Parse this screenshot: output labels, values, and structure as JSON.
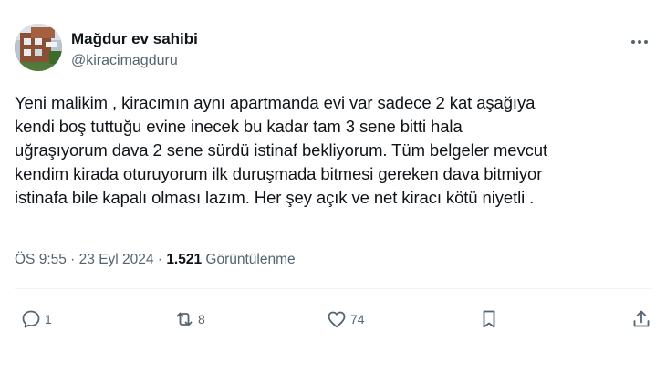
{
  "author": {
    "display_name": "Mağdur ev sahibi",
    "handle": "@kiracimagduru",
    "avatar_icon": "building-photo-avatar"
  },
  "tweet": {
    "lines": [
      "Yeni malikim , kiracımın aynı apartmanda evi var sadece 2 kat aşağıya",
      "kendi boş tuttuğu evine inecek bu kadar tam 3 sene bitti hala",
      "uğraşıyorum dava 2 sene sürdü istinaf bekliyorum. Tüm belgeler mevcut",
      "kendim kirada oturuyorum ilk duruşmada bitmesi gereken dava bitmiyor",
      "istinafa bile kapalı olması lazım. Her şey açık ve net kiracı kötü niyetli ."
    ]
  },
  "meta": {
    "time": "ÖS 9:55",
    "separator1": " · ",
    "date": "23 Eyl 2024",
    "separator2": " · ",
    "views_count": "1.521",
    "views_label": " Görüntülenme"
  },
  "actions": {
    "reply": {
      "icon": "reply-icon",
      "count": "1"
    },
    "retweet": {
      "icon": "retweet-icon",
      "count": "8"
    },
    "like": {
      "icon": "heart-icon",
      "count": "74"
    },
    "bookmark": {
      "icon": "bookmark-icon"
    },
    "share": {
      "icon": "share-icon"
    }
  },
  "colors": {
    "text_primary": "#0f1419",
    "text_secondary": "#536471",
    "divider": "#eff3f4",
    "background": "#ffffff"
  }
}
